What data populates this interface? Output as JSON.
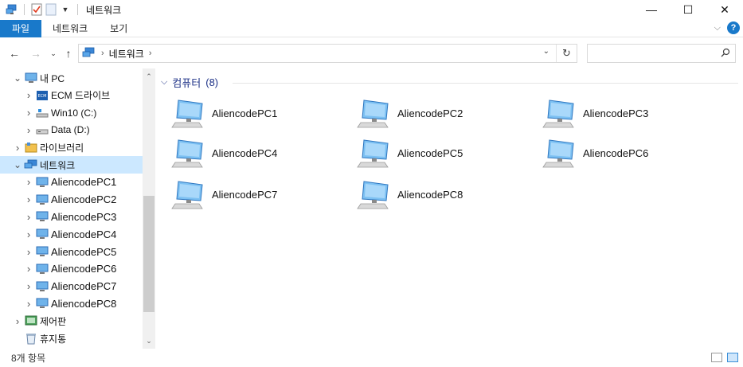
{
  "window": {
    "title": "네트워크",
    "controls": {
      "minimize": "—",
      "maximize": "☐",
      "close": "✕"
    }
  },
  "ribbon": {
    "tabs": [
      "파일",
      "네트워크",
      "보기"
    ]
  },
  "address": {
    "breadcrumb": "네트워크",
    "search_placeholder": ""
  },
  "nav": {
    "items": [
      {
        "label": "내 PC",
        "icon": "pc-icon",
        "arrow": "expanded",
        "level": 0
      },
      {
        "label": "ECM 드라이브",
        "icon": "ecm-drive-icon",
        "arrow": "collapsed",
        "level": 1
      },
      {
        "label": "Win10 (C:)",
        "icon": "windows-drive-icon",
        "arrow": "collapsed",
        "level": 1
      },
      {
        "label": "Data (D:)",
        "icon": "drive-icon",
        "arrow": "collapsed",
        "level": 1
      },
      {
        "label": "라이브러리",
        "icon": "library-icon",
        "arrow": "collapsed",
        "level": 0
      },
      {
        "label": "네트워크",
        "icon": "network-icon",
        "arrow": "expanded",
        "level": 0,
        "selected": true
      },
      {
        "label": "AliencodePC1",
        "icon": "computer-icon",
        "arrow": "collapsed",
        "level": 1
      },
      {
        "label": "AliencodePC2",
        "icon": "computer-icon",
        "arrow": "collapsed",
        "level": 1
      },
      {
        "label": "AliencodePC3",
        "icon": "computer-icon",
        "arrow": "collapsed",
        "level": 1
      },
      {
        "label": "AliencodePC4",
        "icon": "computer-icon",
        "arrow": "collapsed",
        "level": 1
      },
      {
        "label": "AliencodePC5",
        "icon": "computer-icon",
        "arrow": "collapsed",
        "level": 1
      },
      {
        "label": "AliencodePC6",
        "icon": "computer-icon",
        "arrow": "collapsed",
        "level": 1
      },
      {
        "label": "AliencodePC7",
        "icon": "computer-icon",
        "arrow": "collapsed",
        "level": 1
      },
      {
        "label": "AliencodePC8",
        "icon": "computer-icon",
        "arrow": "collapsed",
        "level": 1
      },
      {
        "label": "제어판",
        "icon": "control-panel-icon",
        "arrow": "collapsed",
        "level": 0
      },
      {
        "label": "휴지통",
        "icon": "recycle-bin-icon",
        "arrow": "none",
        "level": 0
      }
    ]
  },
  "content": {
    "group_title": "컴퓨터",
    "group_count": "(8)",
    "computers": [
      "AliencodePC1",
      "AliencodePC2",
      "AliencodePC3",
      "AliencodePC4",
      "AliencodePC5",
      "AliencodePC6",
      "AliencodePC7",
      "AliencodePC8"
    ]
  },
  "status": {
    "item_count": "8개 항목"
  },
  "colors": {
    "accent": "#1979ca",
    "selected_bg": "#cce8ff",
    "group_header": "#1e3287"
  }
}
